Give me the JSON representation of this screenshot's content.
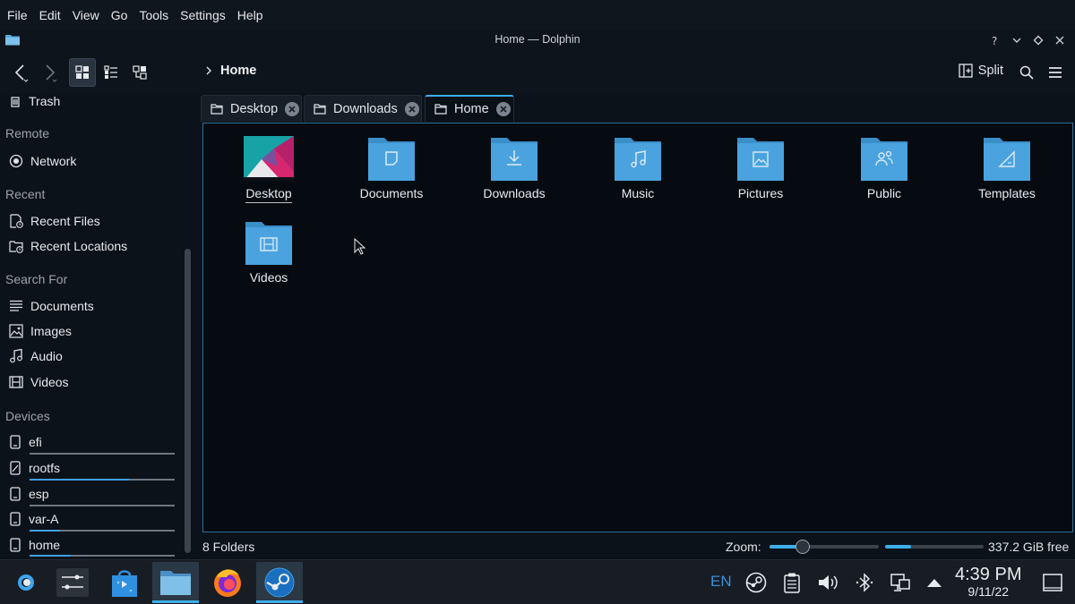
{
  "menu": [
    "File",
    "Edit",
    "View",
    "Go",
    "Tools",
    "Settings",
    "Help"
  ],
  "window": {
    "title": "Home — Dolphin"
  },
  "toolbar": {
    "breadcrumb": "Home",
    "split_label": "Split"
  },
  "sidebar": {
    "places_partial": "Trash",
    "sections": {
      "remote": "Remote",
      "recent": "Recent",
      "search": "Search For",
      "devices": "Devices"
    },
    "remote_items": [
      "Network"
    ],
    "recent_items": [
      "Recent Files",
      "Recent Locations"
    ],
    "search_items": [
      "Documents",
      "Images",
      "Audio",
      "Videos"
    ],
    "devices": [
      {
        "label": "efi",
        "usage": 0.0
      },
      {
        "label": "rootfs",
        "usage": 0.7
      },
      {
        "label": "esp",
        "usage": 0.0
      },
      {
        "label": "var-A",
        "usage": 0.1
      },
      {
        "label": "home",
        "usage": 0.3
      }
    ]
  },
  "tabs": [
    {
      "label": "Desktop",
      "active": false
    },
    {
      "label": "Downloads",
      "active": false
    },
    {
      "label": "Home",
      "active": true
    }
  ],
  "files": [
    {
      "label": "Desktop",
      "icon": "desktop-wallpaper-icon"
    },
    {
      "label": "Documents",
      "icon": "folder-documents-icon"
    },
    {
      "label": "Downloads",
      "icon": "folder-downloads-icon"
    },
    {
      "label": "Music",
      "icon": "folder-music-icon"
    },
    {
      "label": "Pictures",
      "icon": "folder-pictures-icon"
    },
    {
      "label": "Public",
      "icon": "folder-public-icon"
    },
    {
      "label": "Templates",
      "icon": "folder-templates-icon"
    },
    {
      "label": "Videos",
      "icon": "folder-videos-icon"
    }
  ],
  "status": {
    "folder_count": "8 Folders",
    "zoom_label": "Zoom:",
    "zoom_level": 0.3,
    "disk_used_fraction": 0.26,
    "free_space": "337.2 GiB free"
  },
  "taskbar": {
    "language": "EN",
    "time": "4:39 PM",
    "date": "9/11/22"
  },
  "colors": {
    "accent": "#3daee9",
    "folder": "#4aa3df",
    "folder_dark": "#3b8fc9"
  }
}
